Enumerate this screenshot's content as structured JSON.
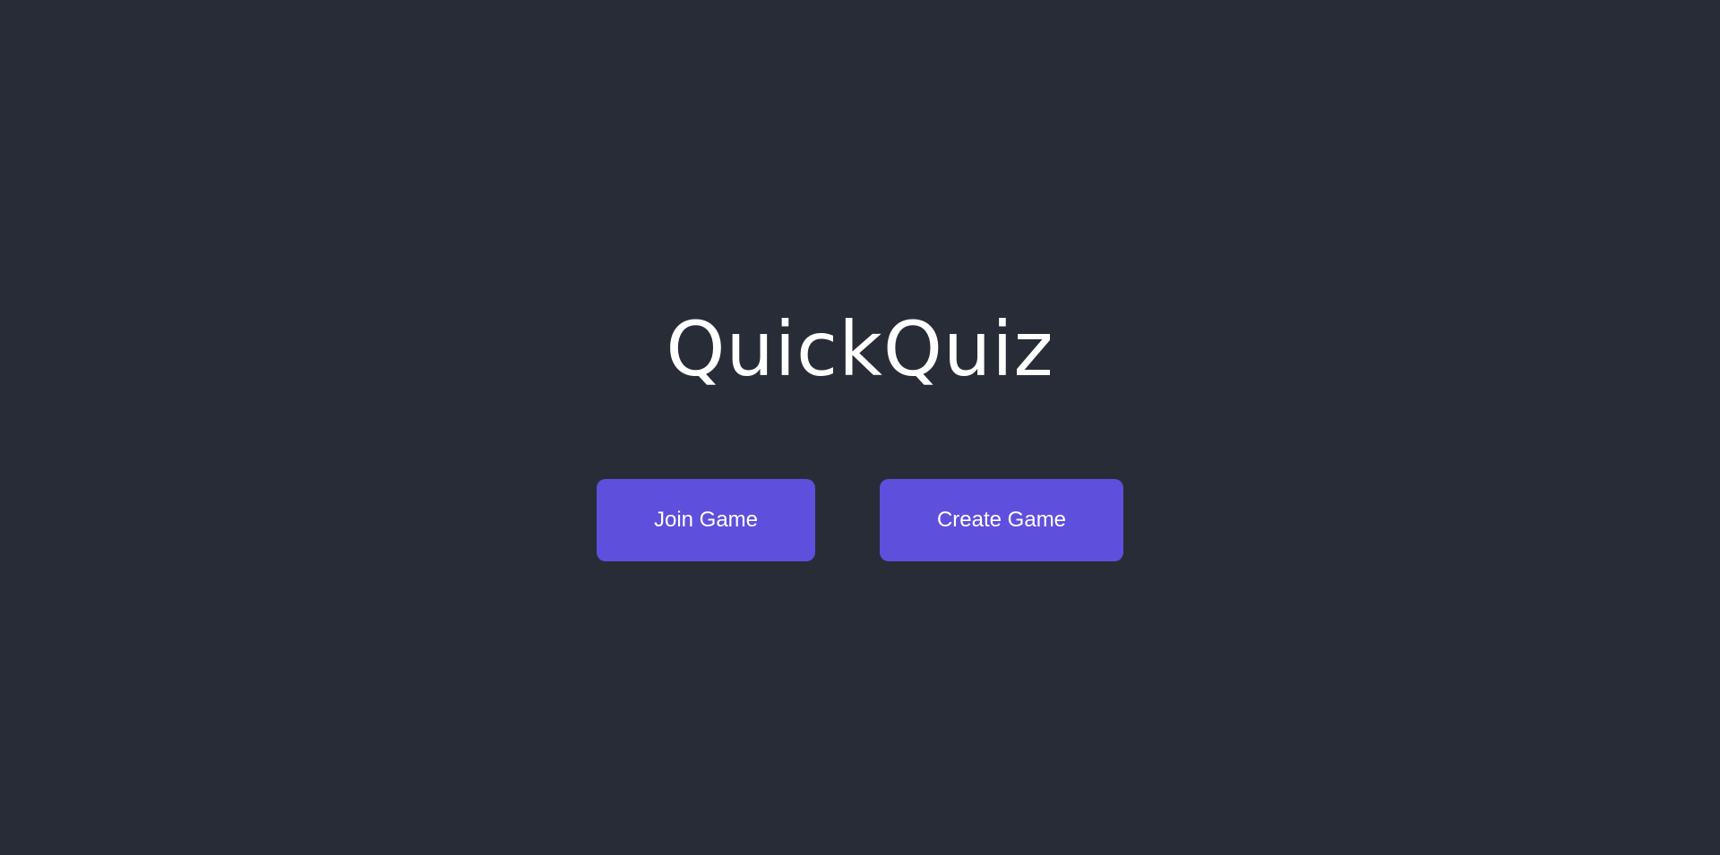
{
  "app": {
    "title": "QuickQuiz"
  },
  "actions": {
    "join_label": "Join Game",
    "create_label": "Create Game"
  },
  "colors": {
    "background": "#282c36",
    "accent": "#5f4fdd",
    "text": "#ffffff"
  }
}
